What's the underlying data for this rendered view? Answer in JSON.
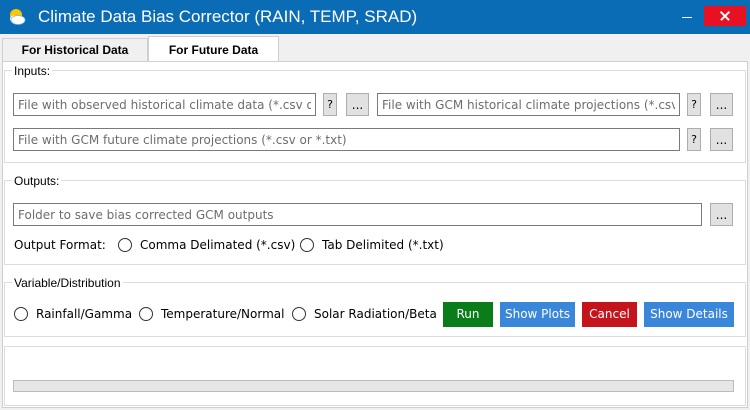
{
  "window": {
    "title": "Climate Data Bias Corrector (RAIN, TEMP, SRAD)"
  },
  "tabs": [
    {
      "label": "For Historical Data",
      "selected": false
    },
    {
      "label": "For Future Data",
      "selected": true
    }
  ],
  "inputs": {
    "label": "Inputs:",
    "observed_historical": {
      "placeholder": "File with observed historical climate data (*.csv o...",
      "value": ""
    },
    "gcm_historical": {
      "placeholder": "File with GCM historical climate projections (*.csv...",
      "value": ""
    },
    "gcm_future": {
      "placeholder": "File with GCM future climate projections (*.csv or *.txt)",
      "value": ""
    },
    "help_label": "?",
    "browse_label": "..."
  },
  "outputs": {
    "label": "Outputs:",
    "folder": {
      "placeholder": "Folder to save bias corrected GCM outputs",
      "value": ""
    },
    "browse_label": "...",
    "format_label": "Output Format:",
    "format_options": [
      "Comma Delimated (*.csv)",
      "Tab Delimited (*.txt)"
    ],
    "selected_format": null
  },
  "variable": {
    "label": "Variable/Distribution",
    "options": [
      "Rainfall/Gamma",
      "Temperature/Normal",
      "Solar Radiation/Beta"
    ],
    "selected": null
  },
  "actions": {
    "run": "Run",
    "show_plots": "Show Plots",
    "cancel": "Cancel",
    "show_details": "Show Details"
  },
  "progress": {
    "percent": 0
  },
  "colors": {
    "titlebar": "#0a6cb5",
    "close_button": "#e81123",
    "run": "#0a7d1a",
    "show_plots": "#3a86d9",
    "cancel": "#c4141c",
    "show_details": "#3a86d9"
  },
  "icons": {
    "app": "weather-sun-cloud-icon",
    "minimize": "minimize-icon",
    "close": "close-icon"
  }
}
